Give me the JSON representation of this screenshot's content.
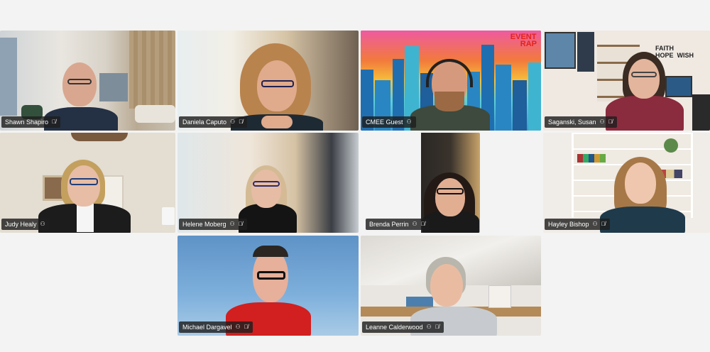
{
  "participants": [
    {
      "name": "Shawn Shapiro",
      "status_icon": "microphone-muted-icon"
    },
    {
      "name": "Daniela Caputo",
      "status_icon": "microphone-muted-icon"
    },
    {
      "name": "CMEE Guest",
      "status_icon": "share-icon"
    },
    {
      "name": "Saganski, Susan",
      "status_icon": "microphone-muted-icon"
    },
    {
      "name": "Judy Healy",
      "status_icon": "share-icon"
    },
    {
      "name": "Helene Moberg",
      "status_icon": "microphone-muted-icon"
    },
    {
      "name": "Brenda Perrin",
      "status_icon": "microphone-muted-icon"
    },
    {
      "name": "Hayley Bishop",
      "status_icon": "microphone-muted-icon"
    },
    {
      "name": "Michael Dargavel",
      "status_icon": "microphone-muted-icon"
    },
    {
      "name": "Leanne Calderwood",
      "status_icon": "microphone-muted-icon"
    }
  ],
  "branding": {
    "logo_line1": "EVENT",
    "logo_line2": "RAP"
  },
  "colors": {
    "background": "#f3f3f3",
    "active_speaker_outline": "#6f6fe0",
    "name_label_bg": "#1e1e1e"
  }
}
